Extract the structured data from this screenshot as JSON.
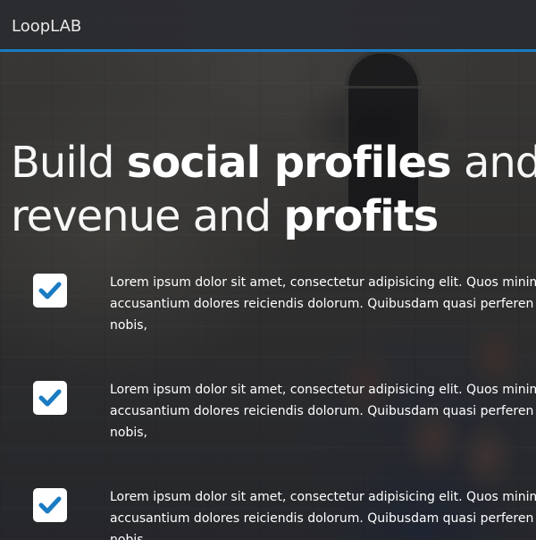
{
  "navbar": {
    "brand": "LoopLAB",
    "accent_color": "#1a7bc2"
  },
  "hero": {
    "headline": {
      "part1": "Build ",
      "part2": "social profiles",
      "part3": " and",
      "part4": "revenue and ",
      "part5": "profits"
    },
    "features": [
      {
        "icon": "checkmark-icon",
        "line1": "Lorem ipsum dolor sit amet, consectetur adipisicing elit. Quos minim",
        "line2": "accusantium dolores reiciendis dolorum. Quibusdam quasi perferen",
        "line3": "nobis,"
      },
      {
        "icon": "checkmark-icon",
        "line1": "Lorem ipsum dolor sit amet, consectetur adipisicing elit. Quos minim",
        "line2": "accusantium dolores reiciendis dolorum. Quibusdam quasi perferen",
        "line3": "nobis,"
      },
      {
        "icon": "checkmark-icon",
        "line1": "Lorem ipsum dolor sit amet, consectetur adipisicing elit. Quos minim",
        "line2": "accusantium dolores reiciendis dolorum. Quibusdam quasi perferen",
        "line3": "nobis,"
      }
    ],
    "check_color": "#1a7bc2"
  }
}
